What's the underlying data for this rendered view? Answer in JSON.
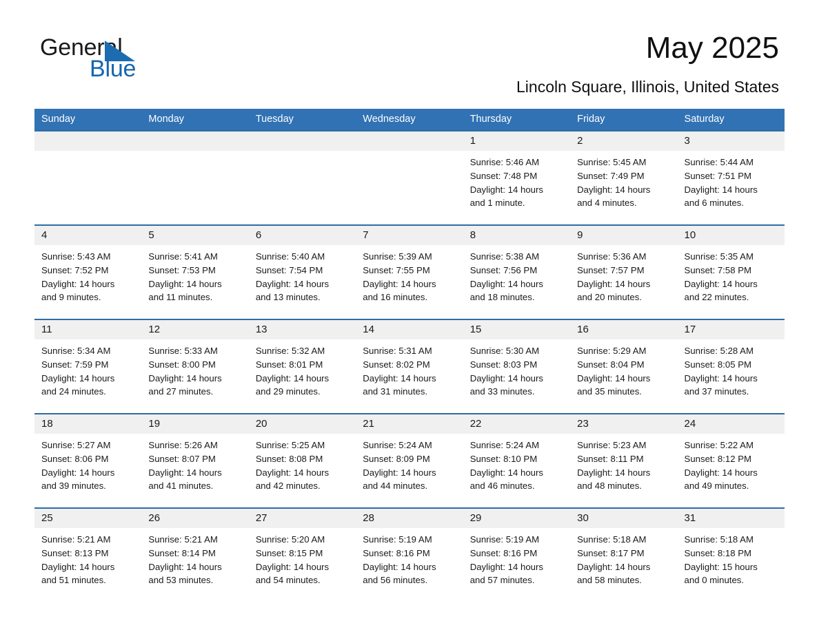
{
  "brand": {
    "line1": "General",
    "line2": "Blue",
    "triangle_color": "#1b6cb0",
    "text_color": "#1a1a1a",
    "blue_text_color": "#1466b0"
  },
  "header": {
    "month_title": "May 2025",
    "location": "Lincoln Square, Illinois, United States"
  },
  "colors": {
    "header_blue": "#3172b4",
    "row_rule_blue": "#2d6da4",
    "daynum_band": "#f0f0f0",
    "page_background": "#ffffff"
  },
  "weekdays": [
    "Sunday",
    "Monday",
    "Tuesday",
    "Wednesday",
    "Thursday",
    "Friday",
    "Saturday"
  ],
  "weeks": [
    [
      {
        "day": "",
        "lines": []
      },
      {
        "day": "",
        "lines": []
      },
      {
        "day": "",
        "lines": []
      },
      {
        "day": "",
        "lines": []
      },
      {
        "day": "1",
        "lines": [
          "Sunrise: 5:46 AM",
          "Sunset: 7:48 PM",
          "Daylight: 14 hours",
          "and 1 minute."
        ]
      },
      {
        "day": "2",
        "lines": [
          "Sunrise: 5:45 AM",
          "Sunset: 7:49 PM",
          "Daylight: 14 hours",
          "and 4 minutes."
        ]
      },
      {
        "day": "3",
        "lines": [
          "Sunrise: 5:44 AM",
          "Sunset: 7:51 PM",
          "Daylight: 14 hours",
          "and 6 minutes."
        ]
      }
    ],
    [
      {
        "day": "4",
        "lines": [
          "Sunrise: 5:43 AM",
          "Sunset: 7:52 PM",
          "Daylight: 14 hours",
          "and 9 minutes."
        ]
      },
      {
        "day": "5",
        "lines": [
          "Sunrise: 5:41 AM",
          "Sunset: 7:53 PM",
          "Daylight: 14 hours",
          "and 11 minutes."
        ]
      },
      {
        "day": "6",
        "lines": [
          "Sunrise: 5:40 AM",
          "Sunset: 7:54 PM",
          "Daylight: 14 hours",
          "and 13 minutes."
        ]
      },
      {
        "day": "7",
        "lines": [
          "Sunrise: 5:39 AM",
          "Sunset: 7:55 PM",
          "Daylight: 14 hours",
          "and 16 minutes."
        ]
      },
      {
        "day": "8",
        "lines": [
          "Sunrise: 5:38 AM",
          "Sunset: 7:56 PM",
          "Daylight: 14 hours",
          "and 18 minutes."
        ]
      },
      {
        "day": "9",
        "lines": [
          "Sunrise: 5:36 AM",
          "Sunset: 7:57 PM",
          "Daylight: 14 hours",
          "and 20 minutes."
        ]
      },
      {
        "day": "10",
        "lines": [
          "Sunrise: 5:35 AM",
          "Sunset: 7:58 PM",
          "Daylight: 14 hours",
          "and 22 minutes."
        ]
      }
    ],
    [
      {
        "day": "11",
        "lines": [
          "Sunrise: 5:34 AM",
          "Sunset: 7:59 PM",
          "Daylight: 14 hours",
          "and 24 minutes."
        ]
      },
      {
        "day": "12",
        "lines": [
          "Sunrise: 5:33 AM",
          "Sunset: 8:00 PM",
          "Daylight: 14 hours",
          "and 27 minutes."
        ]
      },
      {
        "day": "13",
        "lines": [
          "Sunrise: 5:32 AM",
          "Sunset: 8:01 PM",
          "Daylight: 14 hours",
          "and 29 minutes."
        ]
      },
      {
        "day": "14",
        "lines": [
          "Sunrise: 5:31 AM",
          "Sunset: 8:02 PM",
          "Daylight: 14 hours",
          "and 31 minutes."
        ]
      },
      {
        "day": "15",
        "lines": [
          "Sunrise: 5:30 AM",
          "Sunset: 8:03 PM",
          "Daylight: 14 hours",
          "and 33 minutes."
        ]
      },
      {
        "day": "16",
        "lines": [
          "Sunrise: 5:29 AM",
          "Sunset: 8:04 PM",
          "Daylight: 14 hours",
          "and 35 minutes."
        ]
      },
      {
        "day": "17",
        "lines": [
          "Sunrise: 5:28 AM",
          "Sunset: 8:05 PM",
          "Daylight: 14 hours",
          "and 37 minutes."
        ]
      }
    ],
    [
      {
        "day": "18",
        "lines": [
          "Sunrise: 5:27 AM",
          "Sunset: 8:06 PM",
          "Daylight: 14 hours",
          "and 39 minutes."
        ]
      },
      {
        "day": "19",
        "lines": [
          "Sunrise: 5:26 AM",
          "Sunset: 8:07 PM",
          "Daylight: 14 hours",
          "and 41 minutes."
        ]
      },
      {
        "day": "20",
        "lines": [
          "Sunrise: 5:25 AM",
          "Sunset: 8:08 PM",
          "Daylight: 14 hours",
          "and 42 minutes."
        ]
      },
      {
        "day": "21",
        "lines": [
          "Sunrise: 5:24 AM",
          "Sunset: 8:09 PM",
          "Daylight: 14 hours",
          "and 44 minutes."
        ]
      },
      {
        "day": "22",
        "lines": [
          "Sunrise: 5:24 AM",
          "Sunset: 8:10 PM",
          "Daylight: 14 hours",
          "and 46 minutes."
        ]
      },
      {
        "day": "23",
        "lines": [
          "Sunrise: 5:23 AM",
          "Sunset: 8:11 PM",
          "Daylight: 14 hours",
          "and 48 minutes."
        ]
      },
      {
        "day": "24",
        "lines": [
          "Sunrise: 5:22 AM",
          "Sunset: 8:12 PM",
          "Daylight: 14 hours",
          "and 49 minutes."
        ]
      }
    ],
    [
      {
        "day": "25",
        "lines": [
          "Sunrise: 5:21 AM",
          "Sunset: 8:13 PM",
          "Daylight: 14 hours",
          "and 51 minutes."
        ]
      },
      {
        "day": "26",
        "lines": [
          "Sunrise: 5:21 AM",
          "Sunset: 8:14 PM",
          "Daylight: 14 hours",
          "and 53 minutes."
        ]
      },
      {
        "day": "27",
        "lines": [
          "Sunrise: 5:20 AM",
          "Sunset: 8:15 PM",
          "Daylight: 14 hours",
          "and 54 minutes."
        ]
      },
      {
        "day": "28",
        "lines": [
          "Sunrise: 5:19 AM",
          "Sunset: 8:16 PM",
          "Daylight: 14 hours",
          "and 56 minutes."
        ]
      },
      {
        "day": "29",
        "lines": [
          "Sunrise: 5:19 AM",
          "Sunset: 8:16 PM",
          "Daylight: 14 hours",
          "and 57 minutes."
        ]
      },
      {
        "day": "30",
        "lines": [
          "Sunrise: 5:18 AM",
          "Sunset: 8:17 PM",
          "Daylight: 14 hours",
          "and 58 minutes."
        ]
      },
      {
        "day": "31",
        "lines": [
          "Sunrise: 5:18 AM",
          "Sunset: 8:18 PM",
          "Daylight: 15 hours",
          "and 0 minutes."
        ]
      }
    ]
  ]
}
